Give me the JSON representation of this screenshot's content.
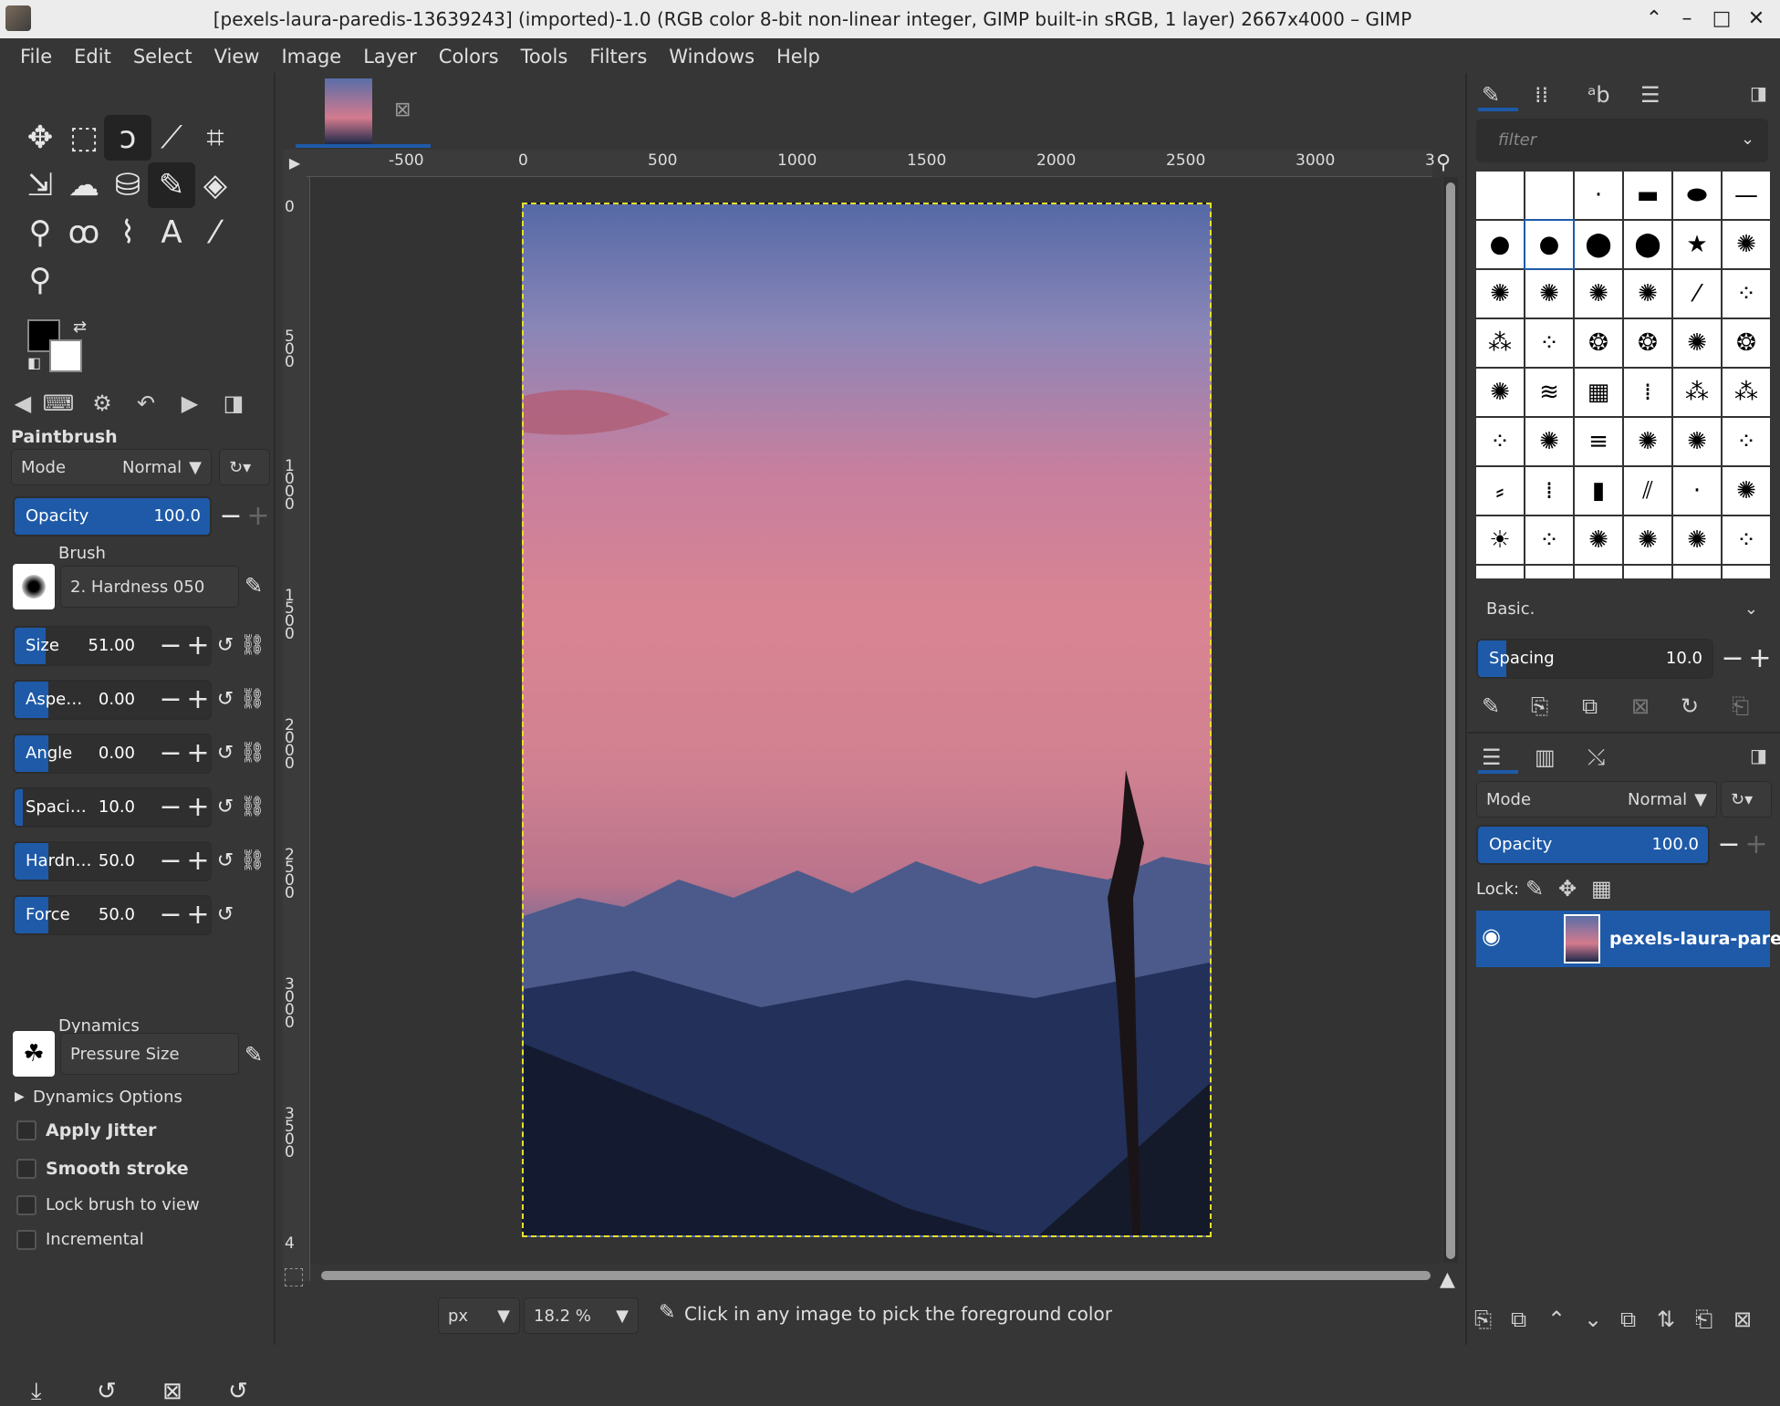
{
  "window": {
    "title": "[pexels-laura-paredis-13639243] (imported)-1.0 (RGB color 8-bit non-linear integer, GIMP built-in sRGB, 1 layer) 2667x4000 – GIMP",
    "btn_up": "⌃",
    "btn_min": "–",
    "btn_max": "□",
    "btn_close": "✕"
  },
  "menu": [
    "File",
    "Edit",
    "Select",
    "View",
    "Image",
    "Layer",
    "Colors",
    "Tools",
    "Filters",
    "Windows",
    "Help"
  ],
  "tools": [
    {
      "name": "move-tool-icon",
      "glyph": "✥"
    },
    {
      "name": "rect-select-icon",
      "glyph": "⬚"
    },
    {
      "name": "free-select-icon",
      "glyph": "ↄ",
      "sel": true
    },
    {
      "name": "fuzzy-select-icon",
      "glyph": "⟋"
    },
    {
      "name": "crop-icon",
      "glyph": "⌗"
    },
    {
      "name": "unified-transform-icon",
      "glyph": "⇲"
    },
    {
      "name": "warp-transform-icon",
      "glyph": "☁"
    },
    {
      "name": "bucket-fill-icon",
      "glyph": "⛁"
    },
    {
      "name": "paintbrush-tool-icon",
      "glyph": "✎",
      "sel": true
    },
    {
      "name": "eraser-icon",
      "glyph": "◈"
    },
    {
      "name": "clone-icon",
      "glyph": "⚲"
    },
    {
      "name": "smudge-icon",
      "glyph": "ꝏ"
    },
    {
      "name": "paths-icon",
      "glyph": "⌇"
    },
    {
      "name": "text-tool-icon",
      "glyph": "A"
    },
    {
      "name": "color-picker-icon",
      "glyph": "⁄"
    },
    {
      "name": "zoom-tool-icon",
      "glyph": "⚲"
    }
  ],
  "options": {
    "title": "Paintbrush",
    "mode_label": "Mode",
    "mode_value": "Normal",
    "opacity_label": "Opacity",
    "opacity_value": "100.0",
    "brush_label": "Brush",
    "brush_value": "2. Hardness 050",
    "sliders": [
      {
        "label": "Size",
        "value": "51.00",
        "fill": 0.45
      },
      {
        "label": "Aspe…",
        "value": "0.00",
        "fill": 0.5
      },
      {
        "label": "Angle",
        "value": "0.00",
        "fill": 0.5
      },
      {
        "label": "Spaci…",
        "value": "10.0",
        "fill": 0.12
      },
      {
        "label": "Hardn…",
        "value": "50.0",
        "fill": 0.5
      },
      {
        "label": "Force",
        "value": "50.0",
        "fill": 0.5
      }
    ],
    "dynamics_label": "Dynamics",
    "dynamics_value": "Pressure Size",
    "dynamics_options": "Dynamics Options",
    "apply_jitter": "Apply Jitter",
    "smooth_stroke": "Smooth stroke",
    "lock_brush": "Lock brush to view",
    "incremental": "Incremental"
  },
  "ruler_h": [
    "-500",
    "0",
    "500",
    "1000",
    "1500",
    "2000",
    "2500",
    "3000",
    "3"
  ],
  "ruler_v": [
    "0",
    "500",
    "1000",
    "1500",
    "2000",
    "2500",
    "3000",
    "3500",
    "4"
  ],
  "status": {
    "unit": "px",
    "zoom": "18.2 %",
    "message": "Click in any image to pick the foreground color"
  },
  "right": {
    "filter_placeholder": "filter",
    "brush_preset": "Basic.",
    "spacing_label": "Spacing",
    "spacing_value": "10.0",
    "layers_mode_label": "Mode",
    "layers_mode_value": "Normal",
    "layers_opacity_label": "Opacity",
    "layers_opacity_value": "100.0",
    "lock_label": "Lock:",
    "layer_name": "pexels-laura-pared"
  }
}
